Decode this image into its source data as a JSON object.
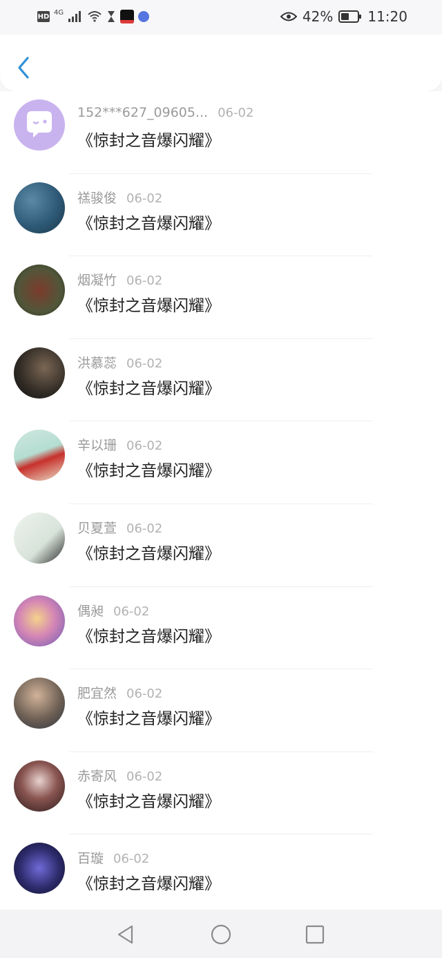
{
  "status_bar": {
    "left_badges": [
      "HD",
      "4G"
    ],
    "battery": "42%",
    "time": "11:20",
    "icons": [
      "signal-icon",
      "wifi-icon",
      "hourglass-icon",
      "tiktok-icon",
      "music-icon",
      "eye-icon",
      "battery-icon"
    ]
  },
  "header": {
    "back_icon": "chevron-left-icon"
  },
  "list": [
    {
      "username": "152***627_09605...",
      "date": "06-02",
      "book": "《惊封之音爆闪耀》",
      "avatar": "chat-bubble-avatar"
    },
    {
      "username": "禚骏俊",
      "date": "06-02",
      "book": "《惊封之音爆闪耀》",
      "avatar": "sky-avatar"
    },
    {
      "username": "烟凝竹",
      "date": "06-02",
      "book": "《惊封之音爆闪耀》",
      "avatar": "flower-avatar"
    },
    {
      "username": "洪慕蕊",
      "date": "06-02",
      "book": "《惊封之音爆闪耀》",
      "avatar": "vase-avatar"
    },
    {
      "username": "辛以珊",
      "date": "06-02",
      "book": "《惊封之音爆闪耀》",
      "avatar": "red-object-avatar"
    },
    {
      "username": "贝夏萱",
      "date": "06-02",
      "book": "《惊封之音爆闪耀》",
      "avatar": "girl-illustration-avatar"
    },
    {
      "username": "偶昶",
      "date": "06-02",
      "book": "《惊封之音爆闪耀》",
      "avatar": "anime-avatar"
    },
    {
      "username": "肥宜然",
      "date": "06-02",
      "book": "《惊封之音爆闪耀》",
      "avatar": "boy-photo-avatar"
    },
    {
      "username": "赤寄风",
      "date": "06-02",
      "book": "《惊封之音爆闪耀》",
      "avatar": "woman-photo-avatar"
    },
    {
      "username": "百璇",
      "date": "06-02",
      "book": "《惊封之音爆闪耀》",
      "avatar": "game-art-avatar"
    }
  ],
  "nav_bar": {
    "back": "triangle-back-icon",
    "home": "circle-home-icon",
    "recents": "square-recents-icon"
  },
  "colors": {
    "accent": "#2e90d6",
    "username": "#9a9a9a",
    "title": "#222222"
  }
}
